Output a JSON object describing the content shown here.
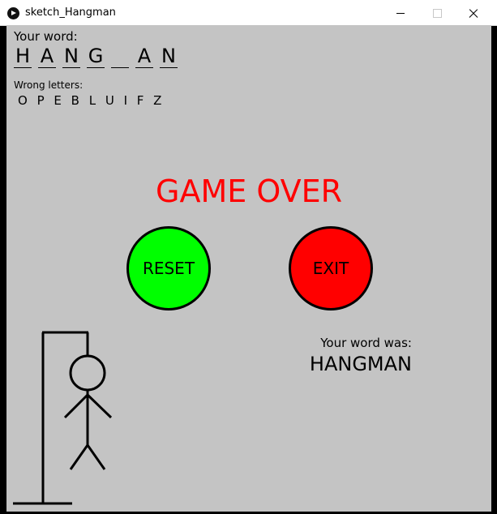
{
  "window": {
    "title": "sketch_Hangman",
    "icon": "processing-play-icon"
  },
  "game": {
    "your_word_label": "Your word:",
    "word_letters": [
      "H",
      "A",
      "N",
      "G",
      "",
      "A",
      "N"
    ],
    "wrong_letters_label": "Wrong letters:",
    "wrong_letters": "O P E B L U I F Z",
    "status": "GAME OVER",
    "reset_label": "RESET",
    "exit_label": "EXIT",
    "word_was_label": "Your word was:",
    "word_was_value": "HANGMAN"
  },
  "colors": {
    "background": "#c4c4c4",
    "game_over": "#ff0000",
    "reset_button": "#00ff00",
    "exit_button": "#ff0000"
  }
}
